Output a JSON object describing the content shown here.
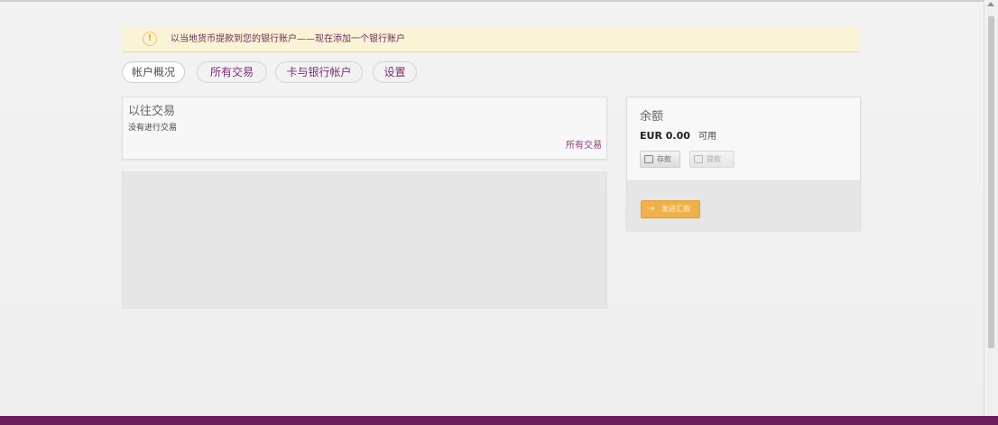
{
  "notice": {
    "icon": "info-icon",
    "text": "以当地货币提款到您的银行账户——现在添加一个银行账户"
  },
  "tabs": [
    {
      "label": "帐户概况",
      "active": true
    },
    {
      "label": "所有交易",
      "active": false
    },
    {
      "label": "卡与银行帐户",
      "active": false
    },
    {
      "label": "设置",
      "active": false
    }
  ],
  "transactions": {
    "title": "以往交易",
    "empty_text": "没有进行交易",
    "link": "所有交易"
  },
  "balance": {
    "title": "余额",
    "amount": "EUR 0.00",
    "status": "可用",
    "deposit_button": "存款",
    "withdraw_button": "提款",
    "send_button": "发送汇款"
  },
  "colors": {
    "brand_purple": "#6a1d5a",
    "notice_bg": "#fbf3d6",
    "send_orange": "#f0b04b"
  }
}
